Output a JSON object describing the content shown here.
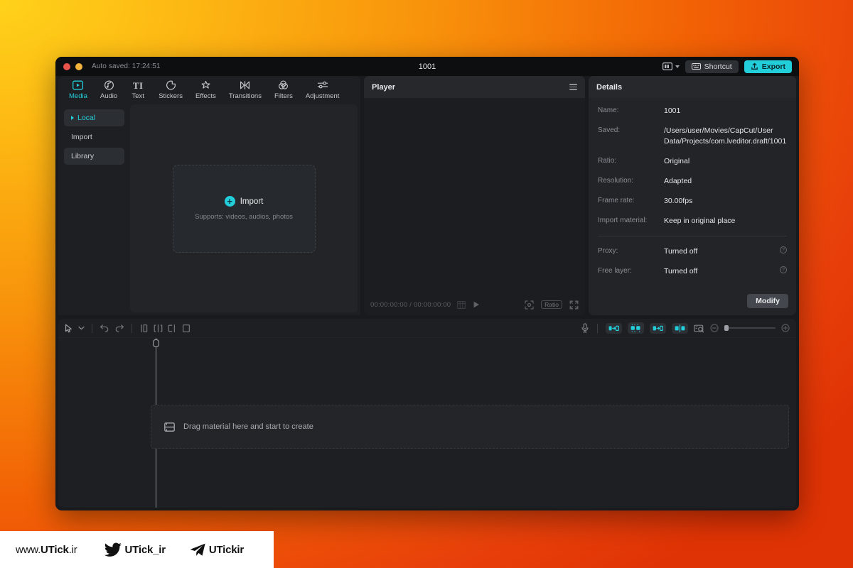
{
  "titlebar": {
    "autosave": "Auto saved: 17:24:51",
    "title": "1001",
    "layout_icon": "layout-icon",
    "shortcut_label": "Shortcut",
    "shortcut_icon": "keyboard-icon",
    "export_label": "Export",
    "export_icon": "upload-icon",
    "export_color": "#23CEDB"
  },
  "tabs": [
    {
      "label": "Media",
      "icon": "media-play-box-icon",
      "active": true
    },
    {
      "label": "Audio",
      "icon": "audio-note-icon",
      "active": false
    },
    {
      "label": "Text",
      "icon": "text-ti-icon",
      "active": false
    },
    {
      "label": "Stickers",
      "icon": "sticker-icon",
      "active": false
    },
    {
      "label": "Effects",
      "icon": "sparkle-star-icon",
      "active": false
    },
    {
      "label": "Transitions",
      "icon": "transition-bowtie-icon",
      "active": false
    },
    {
      "label": "Filters",
      "icon": "filters-circles-icon",
      "active": false
    },
    {
      "label": "Adjustment",
      "icon": "sliders-icon",
      "active": false
    }
  ],
  "library_sidebar": [
    {
      "label": "Local",
      "active": true,
      "boxed": true
    },
    {
      "label": "Import",
      "active": false,
      "boxed": false
    },
    {
      "label": "Library",
      "active": false,
      "boxed": true
    }
  ],
  "dropzone": {
    "title": "Import",
    "subtitle": "Supports: videos, audios, photos",
    "icon": "plus-circle-icon"
  },
  "player": {
    "title": "Player",
    "menu_icon": "hamburger-menu-icon",
    "timecode": "00:00:00:00 / 00:00:00:00",
    "grid_icon": "grid-icon",
    "play_icon": "play-icon",
    "focus_icon": "focus-frame-icon",
    "ratio_label": "Ratio",
    "fullscreen_icon": "fullscreen-icon"
  },
  "details": {
    "title": "Details",
    "rows": [
      {
        "label": "Name:",
        "value": "1001",
        "info": false
      },
      {
        "label": "Saved:",
        "value": "/Users/user/Movies/CapCut/User Data/Projects/com.lveditor.draft/1001",
        "info": false
      },
      {
        "label": "Ratio:",
        "value": "Original",
        "info": false
      },
      {
        "label": "Resolution:",
        "value": "Adapted",
        "info": false
      },
      {
        "label": "Frame rate:",
        "value": "30.00fps",
        "info": false
      },
      {
        "label": "Import material:",
        "value": "Keep in original place",
        "info": false
      }
    ],
    "rows_after_divider": [
      {
        "label": "Proxy:",
        "value": "Turned off",
        "info": true
      },
      {
        "label": "Free layer:",
        "value": "Turned off",
        "info": true
      }
    ],
    "modify_label": "Modify"
  },
  "timeline": {
    "tools": [
      {
        "name": "select-cursor-tool",
        "icon": "cursor-arrow-icon"
      },
      {
        "name": "tool-dropdown",
        "icon": "chevron-down-icon"
      },
      {
        "name": "undo-button",
        "icon": "undo-icon"
      },
      {
        "name": "redo-button",
        "icon": "redo-icon"
      },
      {
        "name": "split-button",
        "icon": "split-icon"
      },
      {
        "name": "trim-left-button",
        "icon": "trim-left-icon"
      },
      {
        "name": "trim-right-button",
        "icon": "trim-right-icon"
      },
      {
        "name": "delete-button",
        "icon": "delete-clip-icon"
      }
    ],
    "right_tools": [
      {
        "name": "record-voiceover-button",
        "icon": "microphone-icon",
        "highlight": false
      },
      {
        "name": "auto-cut-button",
        "icon": "clip-arrow-icon",
        "highlight": true
      },
      {
        "name": "keyframe-button",
        "icon": "keyframe-icon",
        "highlight": true
      },
      {
        "name": "transition-button",
        "icon": "clip-transition-icon",
        "highlight": true
      },
      {
        "name": "mirror-button",
        "icon": "clip-mirror-icon",
        "highlight": true
      },
      {
        "name": "snapshot-button",
        "icon": "snapshot-icon",
        "highlight": false
      }
    ],
    "zoom_out_icon": "zoom-out-icon",
    "zoom_in_icon": "zoom-in-icon",
    "drop_text": "Drag material here and start to create",
    "drop_icon": "track-film-icon"
  },
  "watermark": {
    "site": "www.UTick.ir",
    "site_bold": "UTick",
    "site_prefix": "www.",
    "site_suffix": ".ir",
    "twitter_handle": "UTick_ir",
    "twitter_icon": "twitter-bird-icon",
    "telegram_handle": "UTickir",
    "telegram_icon": "telegram-plane-icon"
  }
}
